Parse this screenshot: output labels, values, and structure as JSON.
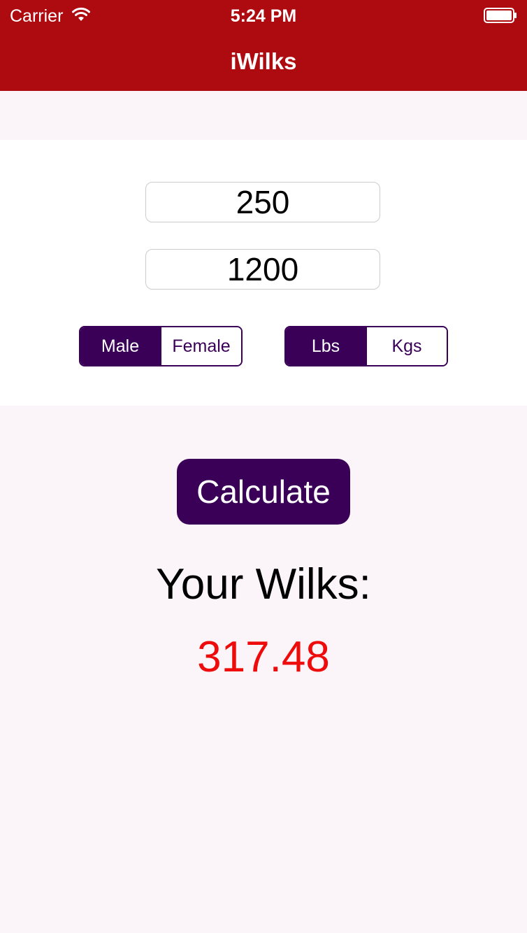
{
  "status_bar": {
    "carrier": "Carrier",
    "time": "5:24 PM",
    "wifi_icon": "wifi-icon",
    "battery_icon": "battery-icon"
  },
  "nav": {
    "title": "iWilks"
  },
  "form": {
    "bodyweight_value": "250",
    "total_value": "1200",
    "gender": {
      "options": [
        "Male",
        "Female"
      ],
      "selected": "Male"
    },
    "unit": {
      "options": [
        "Lbs",
        "Kgs"
      ],
      "selected": "Lbs"
    }
  },
  "actions": {
    "calculate_label": "Calculate"
  },
  "result": {
    "label": "Your Wilks:",
    "value": "317.48"
  },
  "colors": {
    "nav_bar": "#ae0b10",
    "accent": "#3a0058",
    "result_value": "#ee0b0b",
    "background": "#fbf4f8"
  }
}
